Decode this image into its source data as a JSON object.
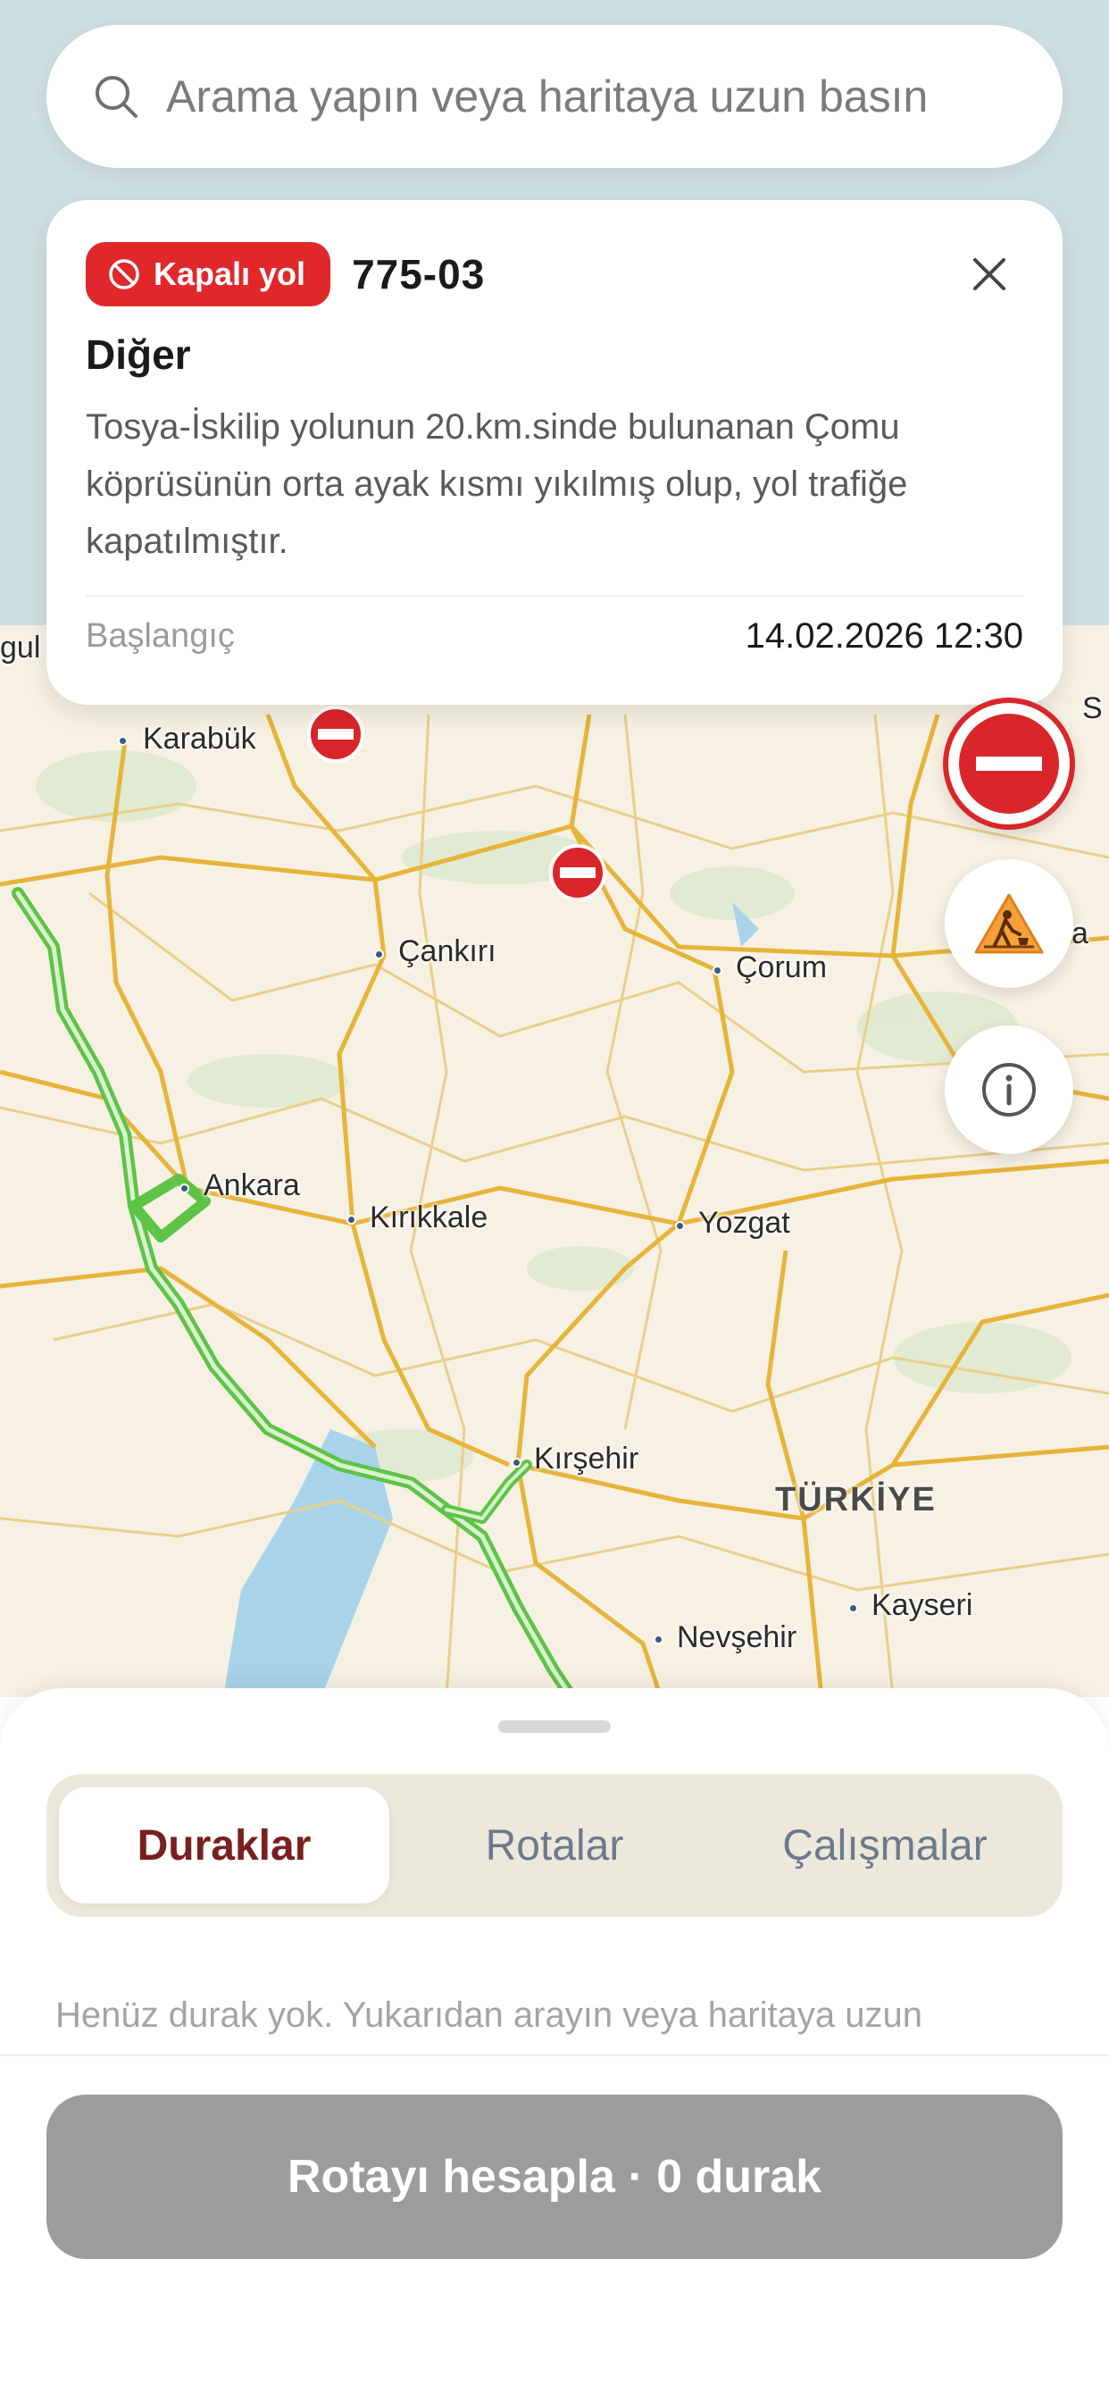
{
  "search": {
    "placeholder": "Arama yapın veya haritaya uzun basın",
    "icon": "search-icon"
  },
  "incident_card": {
    "badge_label": "Kapalı yol",
    "badge_icon": "no-entry-icon",
    "road_code": "775-03",
    "title": "Diğer",
    "description": "Tosya-İskilip yolunun 20.km.sinde bulunanan Çomu köprüsünün orta ayak kısmı yıkılmış olup, yol trafiğe kapatılmıştır.",
    "start_label": "Başlangıç",
    "start_value": "14.02.2026 12:30",
    "close_icon": "close-icon"
  },
  "map": {
    "cities": [
      "Karabük",
      "Çankırı",
      "Çorum",
      "Ankara",
      "Kırıkkale",
      "Yozgat",
      "Kırşehir",
      "Nevşehir",
      "Kayseri"
    ],
    "edge_labels": [
      "gul",
      "S",
      "a"
    ],
    "country": "TÜRKİYE",
    "colors": {
      "land": "#f6f1e3",
      "major_road": "#e7b43a",
      "route": "#5ec347",
      "water": "#a9d3e8",
      "closure": "#d9262b"
    }
  },
  "fabs": {
    "closed_road_icon": "no-entry-icon",
    "roadwork_icon": "roadwork-icon",
    "info_icon": "info-icon"
  },
  "sheet": {
    "tabs": [
      "Duraklar",
      "Rotalar",
      "Çalışmalar"
    ],
    "active_tab": "Duraklar",
    "empty_text": "Henüz durak yok. Yukarıdan arayın veya haritaya uzun",
    "calc_button": "Rotayı hesapla · 0 durak"
  }
}
